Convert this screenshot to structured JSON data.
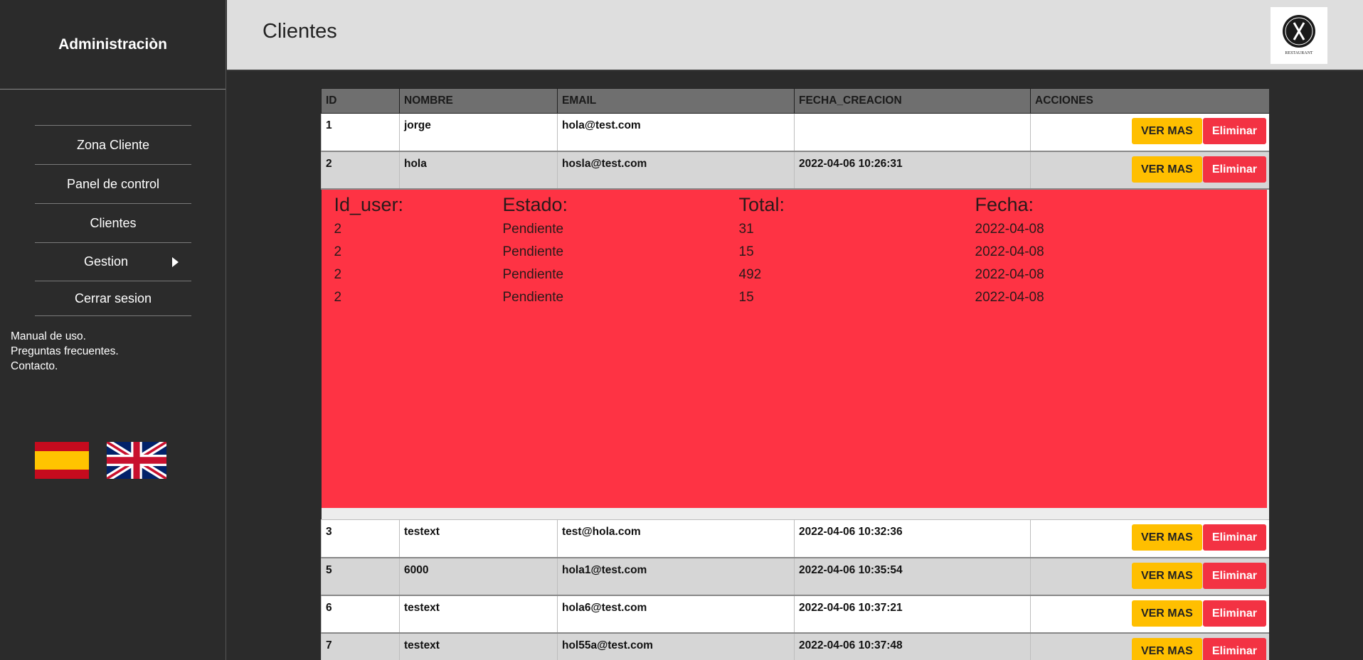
{
  "sidebar": {
    "title": "Administraciòn",
    "nav": [
      {
        "label": "Zona Cliente"
      },
      {
        "label": "Panel de control"
      },
      {
        "label": "Clientes"
      },
      {
        "label": "Gestion"
      },
      {
        "label": "Cerrar sesion"
      }
    ],
    "help": [
      "Manual de uso.",
      "Preguntas frecuentes.",
      "Contacto."
    ],
    "flags": [
      "spain-flag-icon",
      "uk-flag-icon"
    ]
  },
  "header": {
    "title": "Clientes",
    "logo_text": "RESTAURANT"
  },
  "table": {
    "columns": [
      "ID",
      "NOMBRE",
      "EMAIL",
      "FECHA_CREACION",
      "ACCIONES"
    ],
    "btn_ver": "VER MAS",
    "btn_del": "Eliminar",
    "rows": [
      {
        "id": "1",
        "nombre": "jorge",
        "email": "hola@test.com",
        "fecha": ""
      },
      {
        "id": "2",
        "nombre": "hola",
        "email": "hosla@test.com",
        "fecha": "2022-04-06 10:26:31"
      },
      {
        "id": "3",
        "nombre": "testext",
        "email": "test@hola.com",
        "fecha": "2022-04-06 10:32:36"
      },
      {
        "id": "5",
        "nombre": "6000",
        "email": "hola1@test.com",
        "fecha": "2022-04-06 10:35:54"
      },
      {
        "id": "6",
        "nombre": "testext",
        "email": "hola6@test.com",
        "fecha": "2022-04-06 10:37:21"
      },
      {
        "id": "7",
        "nombre": "testext",
        "email": "hol55a@test.com",
        "fecha": "2022-04-06 10:37:48"
      }
    ]
  },
  "detail": {
    "headers": [
      "Id_user:",
      "Estado:",
      "Total:",
      "Fecha:"
    ],
    "rows": [
      [
        "2",
        "Pendiente",
        "31",
        "2022-04-08"
      ],
      [
        "2",
        "Pendiente",
        "15",
        "2022-04-08"
      ],
      [
        "2",
        "Pendiente",
        "492",
        "2022-04-08"
      ],
      [
        "2",
        "Pendiente",
        "15",
        "2022-04-08"
      ]
    ]
  },
  "colors": {
    "accent_yellow": "#ffbf00",
    "accent_red": "#f33243",
    "detail_bg": "#fe3344"
  }
}
